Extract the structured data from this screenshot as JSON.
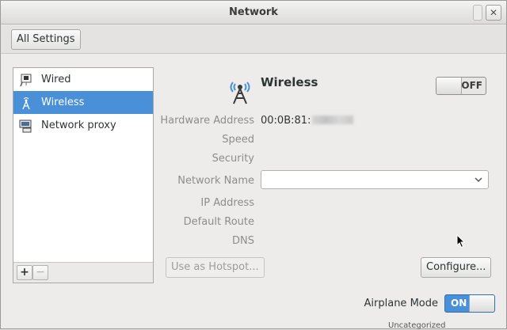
{
  "window": {
    "title": "Network"
  },
  "toolbar": {
    "all_settings_label": "All Settings"
  },
  "sidebar": {
    "items": [
      {
        "label": "Wired",
        "icon": "wired-icon",
        "selected": false
      },
      {
        "label": "Wireless",
        "icon": "wireless-icon",
        "selected": true
      },
      {
        "label": "Network proxy",
        "icon": "proxy-icon",
        "selected": false
      }
    ],
    "add_label": "+",
    "remove_label": "−"
  },
  "details": {
    "title": "Wireless",
    "switch_label": "OFF",
    "properties": {
      "hardware_address_label": "Hardware Address",
      "hardware_address_value": "00:0B:81:",
      "speed_label": "Speed",
      "security_label": "Security",
      "network_name_label": "Network Name",
      "ip_address_label": "IP Address",
      "default_route_label": "Default Route",
      "dns_label": "DNS"
    },
    "hotspot_label": "Use as Hotspot...",
    "configure_label": "Configure..."
  },
  "airplane": {
    "label": "Airplane Mode",
    "switch_label": "ON"
  },
  "background": {
    "partial_text": "Uncategorized"
  },
  "colors": {
    "selection": "#4a90d9",
    "window_bg": "#edeceb"
  }
}
